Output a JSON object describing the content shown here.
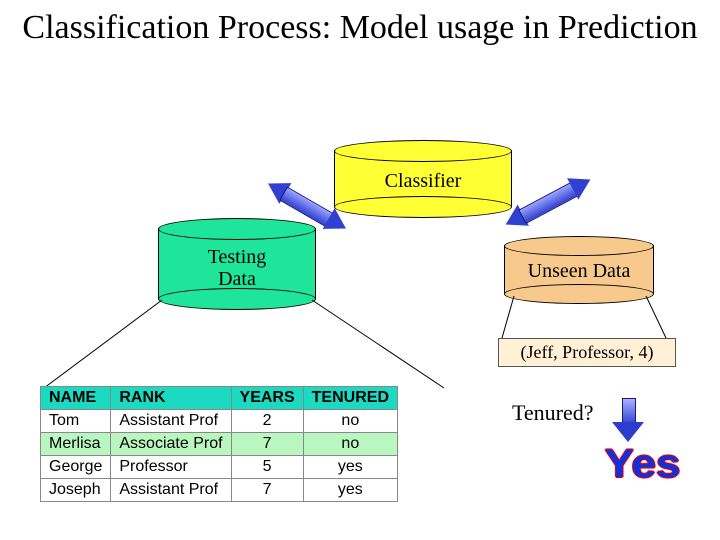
{
  "title": "Classification Process: Model usage in Prediction",
  "nodes": {
    "classifier": "Classifier",
    "testing": "Testing\nData",
    "unseen": "Unseen Data"
  },
  "example_tuple": "(Jeff, Professor, 4)",
  "question": "Tenured?",
  "answer": "Yes",
  "table": {
    "headers": [
      "NAME",
      "RANK",
      "YEARS",
      "TENURED"
    ],
    "rows": [
      {
        "hl": false,
        "cells": [
          "Tom",
          "Assistant Prof",
          "2",
          "no"
        ]
      },
      {
        "hl": true,
        "cells": [
          "Merlisa",
          "Associate Prof",
          "7",
          "no"
        ]
      },
      {
        "hl": false,
        "cells": [
          "George",
          "Professor",
          "5",
          "yes"
        ]
      },
      {
        "hl": false,
        "cells": [
          "Joseph",
          "Assistant Prof",
          "7",
          "yes"
        ]
      }
    ]
  }
}
